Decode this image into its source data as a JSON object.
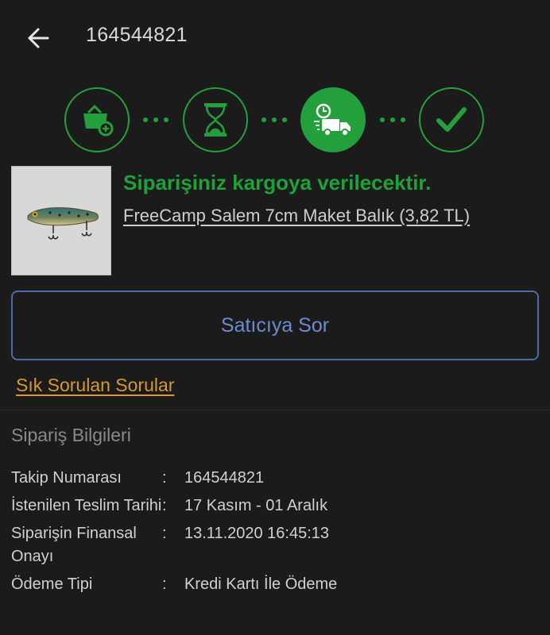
{
  "header": {
    "title": "164544821"
  },
  "colors": {
    "accent_green": "#23a03c",
    "button_blue": "#6d8bd1",
    "link_orange": "#d5992f",
    "background": "#1b1b1b"
  },
  "steps": [
    {
      "icon": "basket-add-icon",
      "active": false
    },
    {
      "icon": "hourglass-icon",
      "active": false
    },
    {
      "icon": "delivery-truck-icon",
      "active": true
    },
    {
      "icon": "checkmark-icon",
      "active": false
    }
  ],
  "order": {
    "status": "Siparişiniz kargoya verilecektir.",
    "product_name": "FreeCamp Salem 7cm Maket Balık (3,82 TL)"
  },
  "actions": {
    "ask_seller": "Satıcıya Sor",
    "faq": "Sık Sorulan Sorular"
  },
  "info": {
    "title": "Sipariş Bilgileri",
    "colon": ":",
    "rows": [
      {
        "label": "Takip Numarası",
        "value": "164544821"
      },
      {
        "label": "İstenilen Teslim Tarihi",
        "value": "17 Kasım - 01 Aralık"
      },
      {
        "label": "Siparişin Finansal Onayı",
        "value": "13.11.2020 16:45:13"
      },
      {
        "label": "Ödeme Tipi",
        "value": "Kredi Kartı İle Ödeme"
      }
    ]
  }
}
